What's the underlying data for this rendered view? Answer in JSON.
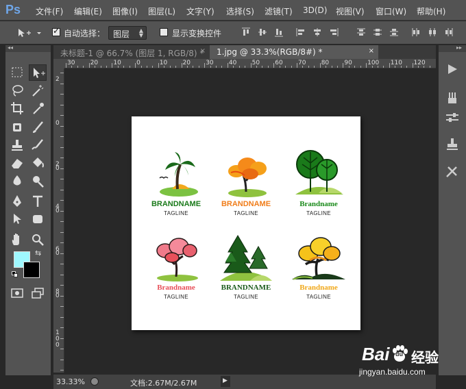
{
  "app": {
    "logo": "Ps"
  },
  "menu": [
    "文件(F)",
    "编辑(E)",
    "图像(I)",
    "图层(L)",
    "文字(Y)",
    "选择(S)",
    "滤镜(T)",
    "3D(D)",
    "视图(V)",
    "窗口(W)",
    "帮助(H)"
  ],
  "options": {
    "auto_select_label": "自动选择：",
    "auto_select_checked": true,
    "auto_select_value": "图层",
    "show_transform_label": "显示变换控件",
    "show_transform_checked": false
  },
  "tabs": [
    {
      "title": "未标题-1 @ 66.7% (图层 1, RGB/8) *",
      "close": "×",
      "active": false
    },
    {
      "title": "1.jpg @ 33.3%(RGB/8#) *",
      "close": "×",
      "active": true
    }
  ],
  "ruler": {
    "top_labels": [
      "30",
      "20",
      "10",
      "0",
      "10",
      "20",
      "30",
      "40",
      "50",
      "60",
      "70",
      "80",
      "90",
      "100",
      "110",
      "120"
    ],
    "left_labels": [
      "2",
      "0",
      "2",
      "0",
      "4",
      "0",
      "6",
      "0",
      "8",
      "0",
      "1\n0\n0"
    ]
  },
  "logos": [
    {
      "brand": "BRANDNAME",
      "tagline": "TAGLINE",
      "color": "#1a7a1a",
      "icon": "palm-tree-icon"
    },
    {
      "brand": "BRANDNAME",
      "tagline": "TAGLINE",
      "color": "#f07d1a",
      "icon": "orange-tree-icon"
    },
    {
      "brand": "Brandname",
      "tagline": "TAGLINE",
      "color": "#1a8a1a",
      "icon": "green-trees-icon"
    },
    {
      "brand": "Brandname",
      "tagline": "TAGLINE",
      "color": "#e8505a",
      "icon": "pink-tree-icon"
    },
    {
      "brand": "BRANDNAME",
      "tagline": "TAGLINE",
      "color": "#1a5a1a",
      "icon": "pine-trees-icon"
    },
    {
      "brand": "Brandname",
      "tagline": "TAGLINE",
      "color": "#f0a81a",
      "icon": "yellow-tree-icon"
    }
  ],
  "colors": {
    "foreground": "#9ff8ff",
    "background": "#000000"
  },
  "status": {
    "zoom": "33.33%",
    "doc_info": "文档:2.67M/2.67M"
  },
  "watermark": {
    "brand": "Bai",
    "paw": "du",
    "suffix": "经验",
    "url": "jingyan.baidu.com"
  }
}
